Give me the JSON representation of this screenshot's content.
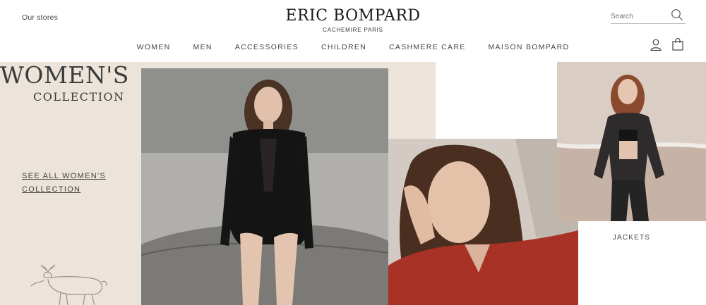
{
  "header": {
    "our_stores": "Our stores",
    "logo_title": "ERIC BOMPARD",
    "logo_subtitle": "CACHEMIRE PARIS",
    "search_placeholder": "Search"
  },
  "nav": {
    "items": [
      "WOMEN",
      "MEN",
      "ACCESSORIES",
      "CHILDREN",
      "CASHMERE CARE",
      "MAISON BOMPARD"
    ]
  },
  "icons": {
    "search": "search-icon",
    "account": "user-icon",
    "cart": "shopping-bag-icon",
    "illustration": "reindeer-illustration"
  },
  "hero": {
    "title": "WOMEN'S",
    "subtitle": "COLLECTION",
    "cta_line1": "SEE ALL WOMEN'S",
    "cta_line2": "COLLECTION"
  },
  "tiles": {
    "jackets_label": "JACKETS"
  },
  "colors": {
    "beige": "#ece4da",
    "text": "#333333"
  }
}
